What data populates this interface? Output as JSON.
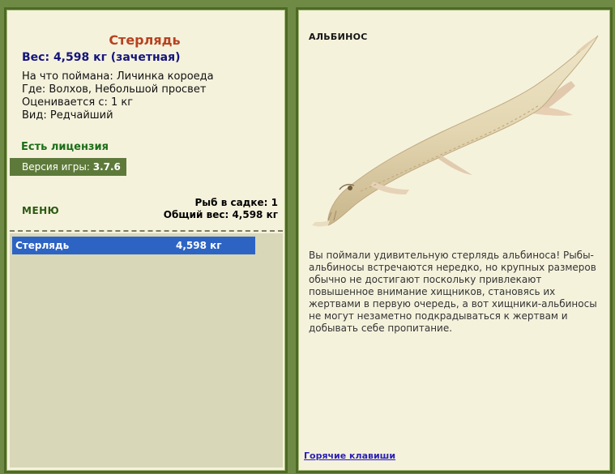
{
  "catch": {
    "title": "Стерлядь",
    "weight": "Вес: 4,598 кг (зачетная)",
    "bait": "На что поймана: Личинка короеда",
    "place": "Где: Волхов, Небольшой просвет",
    "price": "Оценивается с: 1 кг",
    "rarity": "Вид: Редчайший"
  },
  "license": "Есть лицензия",
  "version": {
    "label": "Версия игры:",
    "number": "3.7.6"
  },
  "menu": {
    "label": "МЕНЮ"
  },
  "keepnet": {
    "count_text": "Рыб в садке: 1",
    "total_text": "Общий вес: 4,598 кг",
    "items": [
      {
        "name": "Стерлядь",
        "weight": "4,598 кг",
        "selected": true
      }
    ]
  },
  "albino": {
    "heading": "АЛЬБИНОС",
    "description": "Вы поймали удивительную стерлядь альбиноса! Рыбы-альбиносы встречаются нередко, но крупных размеров обычно не достигают поскольку привлекают повышенное внимание хищников, становясь их жертвами в первую очередь, а вот хищники-альбиносы не могут незаметно подкрадываться к жертвам и добывать себе пропитание."
  },
  "hotkeys": {
    "label": "Горячие клавиши"
  },
  "colors": {
    "frame": "#6f8a44",
    "panel": "#f5f2dc",
    "title": "#b8421f",
    "weight": "#14147d",
    "license": "#1c6e18",
    "selection": "#2d64c4",
    "link": "#2a1fb6"
  }
}
